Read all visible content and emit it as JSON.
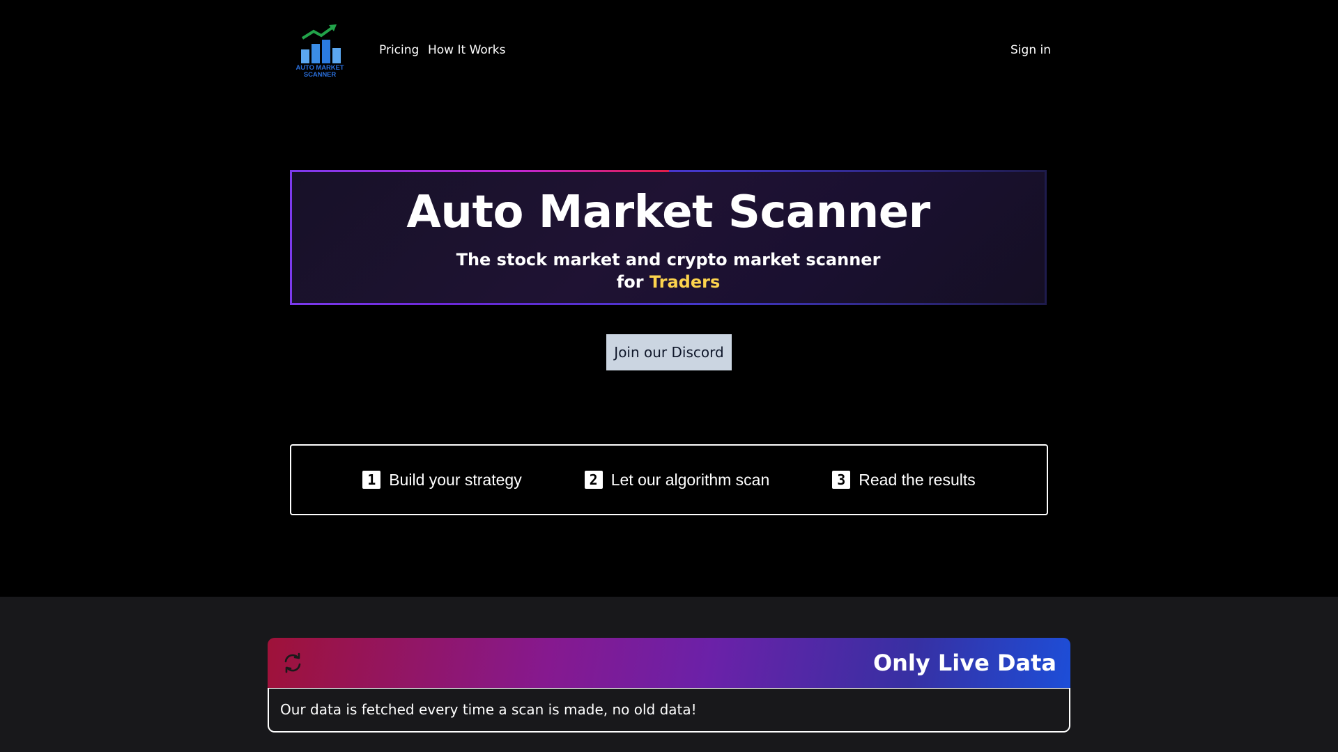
{
  "header": {
    "logo_text": "AUTO MARKET SCANNER",
    "nav": [
      {
        "label": "Pricing"
      },
      {
        "label": "How It Works"
      }
    ],
    "signin_label": "Sign in"
  },
  "hero": {
    "title": "Auto Market Scanner",
    "subtitle_line1": "The stock market and crypto market scanner",
    "subtitle_for": "for",
    "subtitle_highlight": "Traders"
  },
  "discord_button": "Join our Discord",
  "steps": [
    {
      "number": "1",
      "label": "Build your strategy"
    },
    {
      "number": "2",
      "label": "Let our algorithm scan"
    },
    {
      "number": "3",
      "label": "Read the results"
    }
  ],
  "live_card": {
    "icon": "refresh-icon",
    "title": "Only Live Data",
    "body": "Our data is fetched every time a scan is made, no old data!"
  },
  "colors": {
    "background": "#000000",
    "lower_section": "#18181b",
    "highlight": "#fcd34d",
    "button_bg": "#cbd5e1"
  }
}
